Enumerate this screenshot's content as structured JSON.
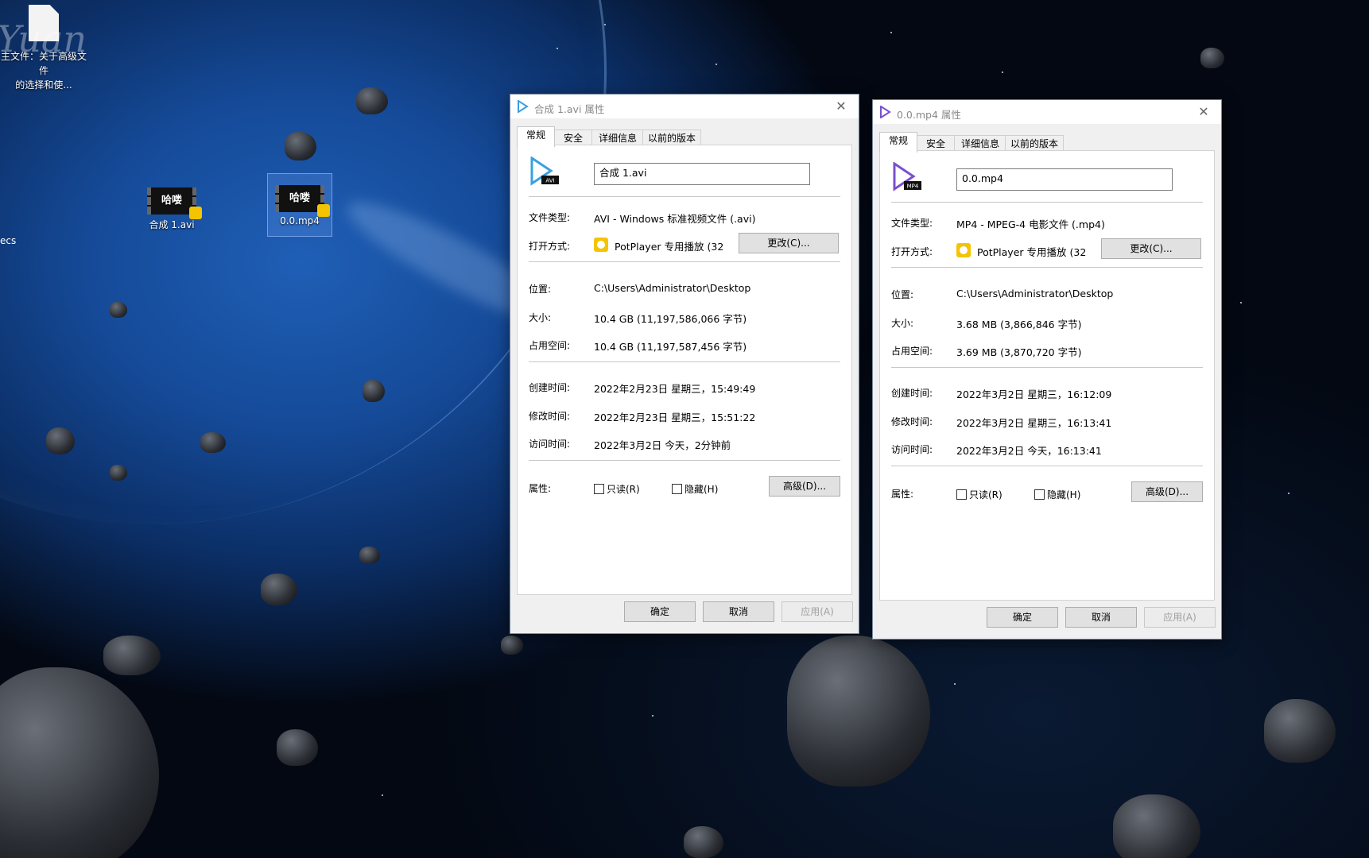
{
  "desktop": {
    "watermark": "Yuan",
    "edge_text_top": "ecs",
    "doc_icon_label_line1": "主文件：关于高级文件",
    "doc_icon_label_line2": "的选择和使...",
    "icons": [
      {
        "label": "合成 1.avi",
        "thumb_text": "哈喽"
      },
      {
        "label": "0.0.mp4",
        "thumb_text": "哈喽"
      }
    ]
  },
  "dialogs": [
    {
      "title": "合成 1.avi 属性",
      "close_glyph": "✕",
      "tabs": [
        "常规",
        "安全",
        "详细信息",
        "以前的版本"
      ],
      "active_tab": "常规",
      "icon_badge": "AVI",
      "file_name": "合成 1.avi",
      "labels": {
        "type": "文件类型:",
        "open_with": "打开方式:",
        "location": "位置:",
        "size": "大小:",
        "size_on_disk": "占用空间:",
        "created": "创建时间:",
        "modified": "修改时间:",
        "accessed": "访问时间:",
        "attributes": "属性:"
      },
      "file_type": "AVI - Windows 标准视频文件 (.avi)",
      "open_with": "PotPlayer 专用播放 (32",
      "change_button": "更改(C)...",
      "location": "C:\\Users\\Administrator\\Desktop",
      "size": "10.4 GB (11,197,586,066 字节)",
      "size_on_disk": "10.4 GB (11,197,587,456 字节)",
      "created": "2022年2月23日 星期三，15:49:49",
      "modified": "2022年2月23日 星期三，15:51:22",
      "accessed": "2022年3月2日 今天，2分钟前",
      "readonly_label": "只读(R)",
      "hidden_label": "隐藏(H)",
      "readonly_checked": false,
      "hidden_checked": false,
      "advanced_button": "高级(D)...",
      "ok_button": "确定",
      "cancel_button": "取消",
      "apply_button": "应用(A)"
    },
    {
      "title": "0.0.mp4 属性",
      "close_glyph": "✕",
      "tabs": [
        "常规",
        "安全",
        "详细信息",
        "以前的版本"
      ],
      "active_tab": "常规",
      "icon_badge": "MP4",
      "file_name": "0.0.mp4",
      "labels": {
        "type": "文件类型:",
        "open_with": "打开方式:",
        "location": "位置:",
        "size": "大小:",
        "size_on_disk": "占用空间:",
        "created": "创建时间:",
        "modified": "修改时间:",
        "accessed": "访问时间:",
        "attributes": "属性:"
      },
      "file_type": "MP4 - MPEG-4 电影文件 (.mp4)",
      "open_with": "PotPlayer 专用播放 (32",
      "change_button": "更改(C)...",
      "location": "C:\\Users\\Administrator\\Desktop",
      "size": "3.68 MB (3,866,846 字节)",
      "size_on_disk": "3.69 MB (3,870,720 字节)",
      "created": "2022年3月2日 星期三，16:12:09",
      "modified": "2022年3月2日 星期三，16:13:41",
      "accessed": "2022年3月2日 今天，16:13:41",
      "readonly_label": "只读(R)",
      "hidden_label": "隐藏(H)",
      "readonly_checked": false,
      "hidden_checked": false,
      "advanced_button": "高级(D)...",
      "ok_button": "确定",
      "cancel_button": "取消",
      "apply_button": "应用(A)"
    }
  ],
  "colors": {
    "potplayer_badge": "#f4c400",
    "avi_icon_accent": "#3aa0e0",
    "mp4_icon_accent": "#7a4fcf"
  }
}
